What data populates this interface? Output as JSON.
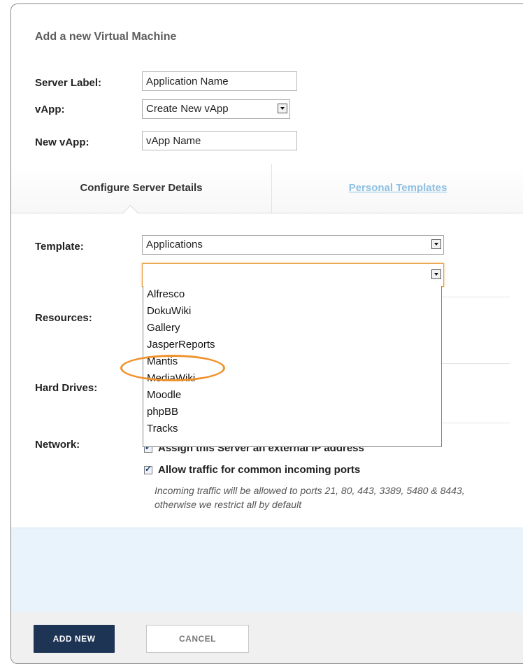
{
  "dialog": {
    "title": "Add a new Virtual Machine"
  },
  "form": {
    "server_label": {
      "label": "Server Label:",
      "value": "Application Name"
    },
    "vapp": {
      "label": "vApp:",
      "value": "Create New vApp"
    },
    "new_vapp": {
      "label": "New vApp:",
      "value": "vApp Name"
    }
  },
  "tabs": {
    "configure": "Configure Server Details",
    "personal": "Personal Templates"
  },
  "details": {
    "template_label": "Template:",
    "template_value": "Applications",
    "app_value": "",
    "resources_label": "Resources:",
    "hard_drives_label": "Hard Drives:",
    "network_label": "Network:"
  },
  "app_options": [
    "Alfresco",
    "DokuWiki",
    "Gallery",
    "JasperReports",
    "Mantis",
    "MediaWiki",
    "Moodle",
    "phpBB",
    "Tracks"
  ],
  "network": {
    "assign_ip_label": "Assign this Server an external IP address",
    "allow_traffic_label": "Allow traffic for common incoming ports",
    "traffic_note": "Incoming traffic will be allowed to ports 21, 80, 443, 3389, 5480 & 8443, otherwise we restrict all by default"
  },
  "buttons": {
    "add_new": "ADD NEW",
    "cancel": "CANCEL"
  },
  "colors": {
    "primary_button": "#1d3455",
    "link": "#8ec0e3",
    "highlight": "#f0922c",
    "band": "#e8f3fb"
  }
}
